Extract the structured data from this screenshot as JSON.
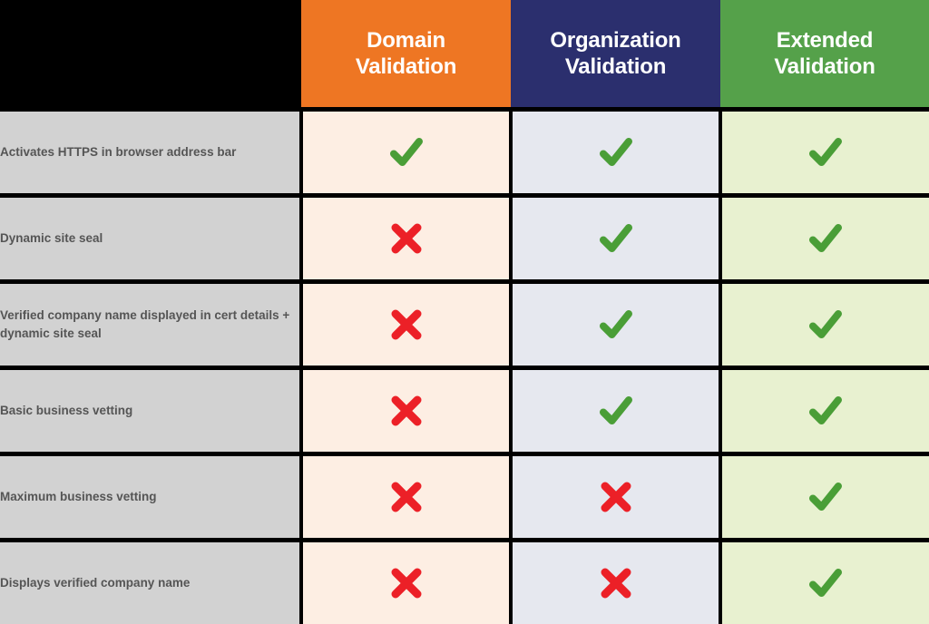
{
  "table": {
    "corner_label": "",
    "columns": [
      {
        "id": "dv",
        "label_line1": "Domain",
        "label_line2": "Validation",
        "header_color": "#ee7623",
        "cell_color": "#fdeee3"
      },
      {
        "id": "ov",
        "label_line1": "Organization",
        "label_line2": "Validation",
        "header_color": "#2b2f6e",
        "cell_color": "#e6e8ef"
      },
      {
        "id": "ev",
        "label_line1": "Extended",
        "label_line2": "Validation",
        "header_color": "#55a14a",
        "cell_color": "#e8f1d0"
      }
    ],
    "marks": {
      "check_name": "check-icon",
      "cross_name": "cross-icon",
      "check_color": "#4a9e37",
      "cross_color": "#ec2027"
    },
    "rows": [
      {
        "feature": "Activates HTTPS in browser address bar",
        "values": [
          "check",
          "check",
          "check"
        ]
      },
      {
        "feature": "Dynamic site seal",
        "values": [
          "cross",
          "check",
          "check"
        ]
      },
      {
        "feature": "Verified company name displayed in cert details + dynamic site seal",
        "values": [
          "cross",
          "check",
          "check"
        ]
      },
      {
        "feature": "Basic business vetting",
        "values": [
          "cross",
          "check",
          "check"
        ]
      },
      {
        "feature": "Maximum business vetting",
        "values": [
          "cross",
          "cross",
          "check"
        ]
      },
      {
        "feature": "Displays verified company name",
        "values": [
          "cross",
          "cross",
          "check"
        ]
      }
    ]
  }
}
